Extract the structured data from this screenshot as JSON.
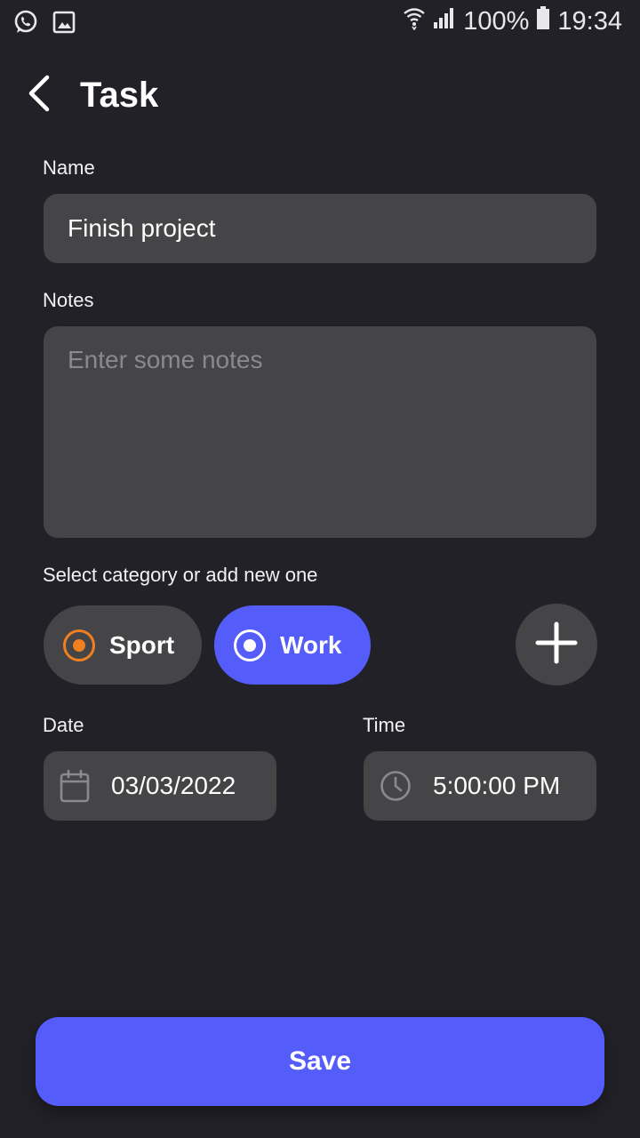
{
  "status_bar": {
    "battery": "100%",
    "time": "19:34",
    "icons": [
      "whatsapp-icon",
      "gallery-icon",
      "wifi-icon",
      "signal-icon",
      "battery-icon"
    ]
  },
  "header": {
    "title": "Task",
    "back_icon": "chevron-left-icon"
  },
  "form": {
    "name_label": "Name",
    "name_value": "Finish project",
    "notes_label": "Notes",
    "notes_placeholder": "Enter some notes",
    "notes_value": "",
    "category_label": "Select category or add new one",
    "categories": [
      {
        "label": "Sport",
        "selected": false,
        "color": "#f0801f"
      },
      {
        "label": "Work",
        "selected": true,
        "color": "#545cf9"
      }
    ],
    "add_category_icon": "plus-icon",
    "date_label": "Date",
    "date_value": "03/03/2022",
    "time_label": "Time",
    "time_value": "5:00:00 PM"
  },
  "save_label": "Save",
  "colors": {
    "background": "#222128",
    "field": "#454547",
    "accent": "#545cf9",
    "sport": "#f0801f"
  }
}
